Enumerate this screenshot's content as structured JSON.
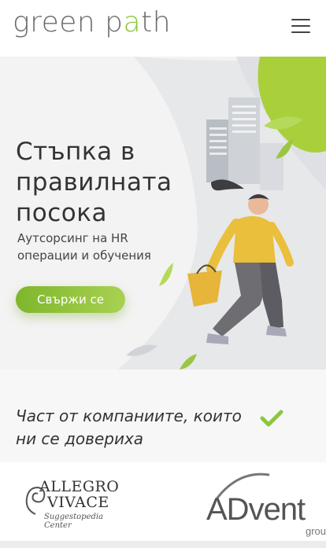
{
  "header": {
    "logo_part1": "green p",
    "logo_accent": "a",
    "logo_part2": "th",
    "menu_icon": "hamburger-icon"
  },
  "hero": {
    "title": "Стъпка в правилната посока",
    "subtitle": "Аутсорсинг на HR операции и обучения",
    "cta_label": "Свържи се"
  },
  "clients": {
    "heading": "Част от компаниите, които ни се довериха",
    "check_icon": "checkmark-icon"
  },
  "client_logos": {
    "allegro_line1": "ALLEGRO",
    "allegro_line2": "VIVACE",
    "allegro_tag": "Suggestopedia Center",
    "advent_text": "ADvent",
    "advent_sub": "group"
  },
  "colors": {
    "brand_green": "#8cc63f",
    "text_dark": "#333333",
    "hero_bg": "#f3f3f3"
  }
}
